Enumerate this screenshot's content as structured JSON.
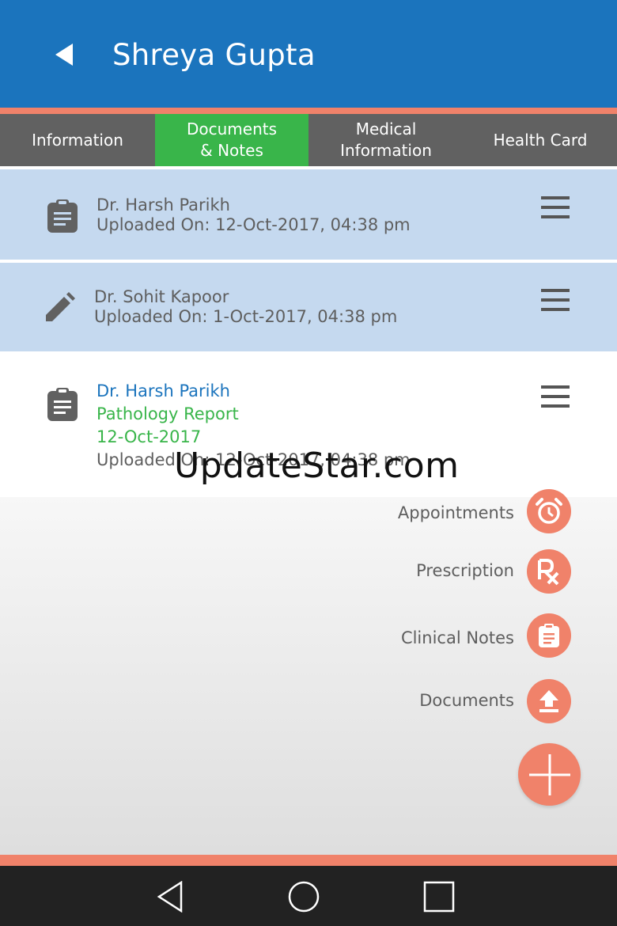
{
  "header": {
    "title": "Shreya Gupta",
    "back_icon": "back-arrow-icon"
  },
  "tabs": [
    {
      "label": "Information",
      "active": false
    },
    {
      "label": "Documents & Notes",
      "active": true
    },
    {
      "label": "Medical Information",
      "active": false
    },
    {
      "label": "Health Card",
      "active": false
    }
  ],
  "records": [
    {
      "icon": "clipboard-icon",
      "doctor": "Dr. Harsh Parikh",
      "uploaded": "Uploaded On: 12-Oct-2017, 04:38 pm",
      "selected": true
    },
    {
      "icon": "pencil-icon",
      "doctor": "Dr. Sohit Kapoor",
      "uploaded": "Uploaded On: 1-Oct-2017, 04:38 pm",
      "selected": true
    },
    {
      "icon": "clipboard-icon",
      "doctor": "Dr. Harsh Parikh",
      "type": "Pathology Report",
      "date": "12-Oct-2017",
      "uploaded": "Uploaded On: 12-Oct-2017, 04:38 pm",
      "selected": false
    }
  ],
  "watermark": "UpdateStar.com",
  "fab_menu": [
    {
      "label": "Appointments",
      "icon": "alarm-clock-icon"
    },
    {
      "label": "Prescription",
      "icon": "rx-icon"
    },
    {
      "label": "Clinical Notes",
      "icon": "clipboard-icon"
    },
    {
      "label": "Documents",
      "icon": "upload-icon"
    }
  ],
  "colors": {
    "primary": "#1b74bd",
    "accent": "#f0826a",
    "tab_active": "#39b54a",
    "tab_bg": "#616161",
    "selected_row": "#c5d9ef"
  }
}
